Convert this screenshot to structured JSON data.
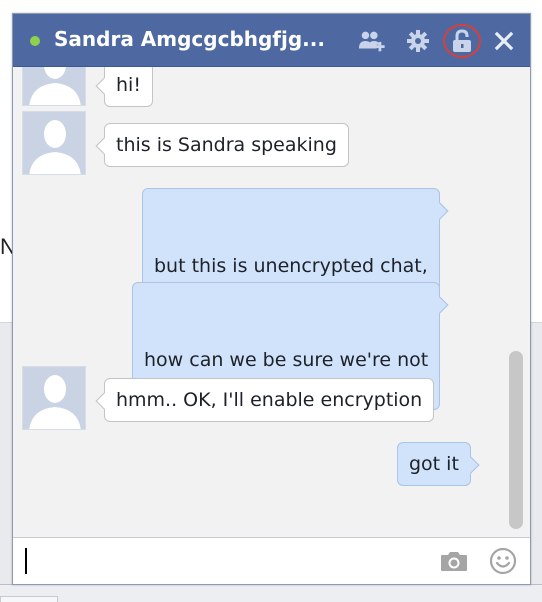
{
  "background": {
    "letter": "N"
  },
  "chat": {
    "status": "online",
    "title": "Sandra Amgcgcbhgfjg...",
    "icons": {
      "add_friends": "add-friends-icon",
      "settings": "gear-icon",
      "encryption": "unlocked-padlock-icon",
      "close": "close-icon",
      "camera": "camera-icon",
      "emoji": "smiley-icon"
    },
    "colors": {
      "header": "#4e69a2",
      "online_dot": "#8fd14f",
      "highlight_ring": "#d6403a",
      "outgoing_bubble": "#d1e3fb"
    },
    "messages": [
      {
        "direction": "in",
        "text": "hi!"
      },
      {
        "direction": "in",
        "text": "this is Sandra speaking"
      },
      {
        "direction": "out",
        "text": "but this is unencrypted chat,\nSandra!"
      },
      {
        "direction": "out",
        "text": "how can we be sure we're not\nbeing watched?"
      },
      {
        "direction": "in",
        "text": "hmm.. OK, I'll enable encryption"
      },
      {
        "direction": "out",
        "text": "got it"
      }
    ],
    "composer": {
      "value": "",
      "placeholder": ""
    }
  }
}
